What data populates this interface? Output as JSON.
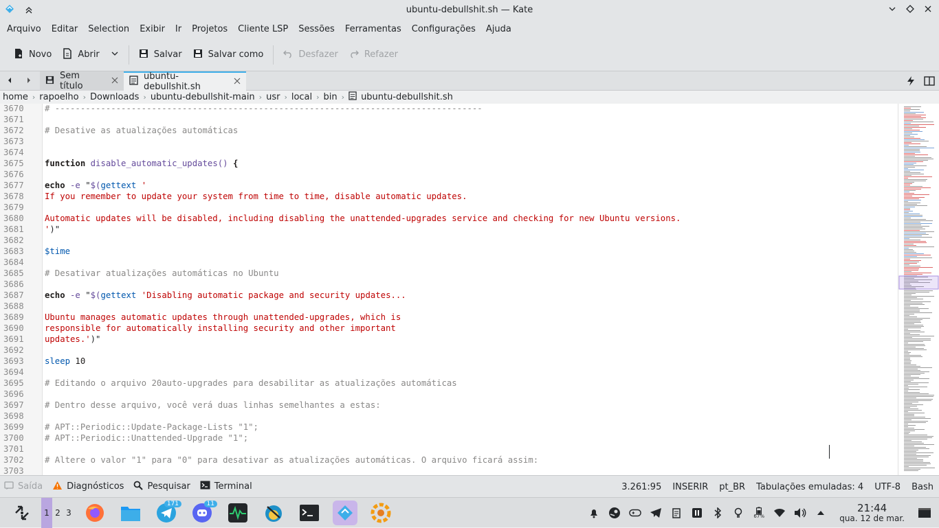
{
  "window": {
    "title": "ubuntu-debullshit.sh — Kate"
  },
  "menu": [
    "Arquivo",
    "Editar",
    "Selection",
    "Exibir",
    "Ir",
    "Projetos",
    "Cliente LSP",
    "Sessões",
    "Ferramentas",
    "Configurações",
    "Ajuda"
  ],
  "toolbar": {
    "new_label": "Novo",
    "open_label": "Abrir",
    "save_label": "Salvar",
    "save_as_label": "Salvar como",
    "undo_label": "Desfazer",
    "redo_label": "Refazer"
  },
  "tabs": [
    {
      "label": "Sem título"
    },
    {
      "label": "ubuntu-debullshit.sh"
    }
  ],
  "breadcrumb": [
    "home",
    "rapoelho",
    "Downloads",
    "ubuntu-debullshit-main",
    "usr",
    "local",
    "bin",
    "ubuntu-debullshit.sh"
  ],
  "code": [
    {
      "n": "3670",
      "parts": [
        [
          "c-comment",
          "# ------------------------------------------------------------------------------------"
        ]
      ]
    },
    {
      "n": "3671",
      "parts": []
    },
    {
      "n": "3672",
      "parts": [
        [
          "c-comment",
          "# Desative as atualizações automáticas"
        ]
      ]
    },
    {
      "n": "3673",
      "parts": []
    },
    {
      "n": "3674",
      "parts": []
    },
    {
      "n": "3675",
      "parts": [
        [
          "c-kw",
          "function "
        ],
        [
          "c-fn",
          "disable_automatic_updates() "
        ],
        [
          "c-kw",
          "{"
        ]
      ]
    },
    {
      "n": "3676",
      "parts": []
    },
    {
      "n": "3677",
      "parts": [
        [
          "c-kw",
          "echo "
        ],
        [
          "c-fn",
          "-e "
        ],
        [
          "",
          "\""
        ],
        [
          "c-fn",
          "$("
        ],
        [
          "c-var",
          "gettext "
        ],
        [
          "c-str",
          "'"
        ]
      ]
    },
    {
      "n": "3678",
      "parts": [
        [
          "c-str",
          "If you remember to update your system from time to time, disable automatic updates."
        ]
      ]
    },
    {
      "n": "3679",
      "parts": []
    },
    {
      "n": "3680",
      "parts": [
        [
          "c-str",
          "Automatic updates will be disabled, including disabling the unattended-upgrades service and checking for new Ubuntu versions."
        ]
      ]
    },
    {
      "n": "3681",
      "parts": [
        [
          "c-str",
          "'"
        ],
        [
          "",
          ")\""
        ]
      ]
    },
    {
      "n": "3682",
      "parts": []
    },
    {
      "n": "3683",
      "parts": [
        [
          "c-var",
          "$time"
        ]
      ]
    },
    {
      "n": "3684",
      "parts": []
    },
    {
      "n": "3685",
      "parts": [
        [
          "c-comment",
          "# Desativar atualizações automáticas no Ubuntu"
        ]
      ]
    },
    {
      "n": "3686",
      "parts": []
    },
    {
      "n": "3687",
      "parts": [
        [
          "c-kw",
          "echo "
        ],
        [
          "c-fn",
          "-e "
        ],
        [
          "",
          "\""
        ],
        [
          "c-fn",
          "$("
        ],
        [
          "c-var",
          "gettext "
        ],
        [
          "c-str",
          "'Disabling automatic package and security updates..."
        ]
      ]
    },
    {
      "n": "3688",
      "parts": []
    },
    {
      "n": "3689",
      "parts": [
        [
          "c-str",
          "Ubuntu manages automatic updates through unattended-upgrades, which is"
        ]
      ]
    },
    {
      "n": "3690",
      "parts": [
        [
          "c-str",
          "responsible for automatically installing security and other important"
        ]
      ]
    },
    {
      "n": "3691",
      "parts": [
        [
          "c-str",
          "updates.'"
        ],
        [
          "",
          ")\""
        ]
      ]
    },
    {
      "n": "3692",
      "parts": []
    },
    {
      "n": "3693",
      "parts": [
        [
          "c-var",
          "sleep "
        ],
        [
          "c-num",
          "10"
        ]
      ]
    },
    {
      "n": "3694",
      "parts": []
    },
    {
      "n": "3695",
      "parts": [
        [
          "c-comment",
          "# Editando o arquivo 20auto-upgrades para desabilitar as atualizações automáticas"
        ]
      ]
    },
    {
      "n": "3696",
      "parts": []
    },
    {
      "n": "3697",
      "parts": [
        [
          "c-comment",
          "# Dentro desse arquivo, você verá duas linhas semelhantes a estas:"
        ]
      ]
    },
    {
      "n": "3698",
      "parts": []
    },
    {
      "n": "3699",
      "parts": [
        [
          "c-comment",
          "# APT::Periodic::Update-Package-Lists \"1\";"
        ]
      ]
    },
    {
      "n": "3700",
      "parts": [
        [
          "c-comment",
          "# APT::Periodic::Unattended-Upgrade \"1\";"
        ]
      ]
    },
    {
      "n": "3701",
      "parts": []
    },
    {
      "n": "3702",
      "parts": [
        [
          "c-comment",
          "# Altere o valor \"1\" para \"0\" para desativar as atualizações automáticas. O arquivo ficará assim:"
        ]
      ]
    },
    {
      "n": "3703",
      "parts": []
    }
  ],
  "statusbar": {
    "output": "Saída",
    "diagnostics": "Diagnósticos",
    "search": "Pesquisar",
    "terminal": "Terminal",
    "cursor_pos": "3.261:95",
    "mode": "INSERIR",
    "lang": "pt_BR",
    "indent": "Tabulações emuladas: 4",
    "encoding": "UTF-8",
    "syntax": "Bash"
  },
  "taskbar": {
    "desktops": [
      "1",
      "2",
      "3"
    ],
    "telegram_badge": "171",
    "discord_badge": "11",
    "time": "21:44",
    "date": "qua. 12 de mar.",
    "battery_percent": "67%"
  },
  "colors": {
    "accent": "#3daee9",
    "string": "#bf0303",
    "comment": "#898887",
    "keyword": "#1f1c1b",
    "function": "#644a9b",
    "variable": "#0057ae"
  }
}
